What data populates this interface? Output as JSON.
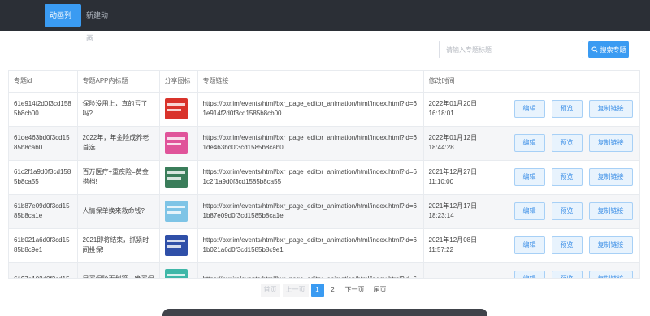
{
  "nav": {
    "items": [
      {
        "label": "动画列表",
        "active": true
      },
      {
        "label": "新建动画",
        "active": false
      }
    ]
  },
  "search": {
    "placeholder": "请输入专题标题",
    "value": "",
    "button_label": "搜索专题"
  },
  "table": {
    "headers": [
      "专题id",
      "专题APP内标题",
      "分享图标",
      "专题链接",
      "修改时间",
      ""
    ],
    "rows": [
      {
        "id": "61e914f2d0f3cd1585b8cb00",
        "title": "保险没用上，真的亏了吗?",
        "thumb_color": "#d9332b",
        "link": "https://bxr.im/events/html/bxr_page_editor_animation/html/index.html?id=61e914f2d0f3cd1585b8cb00",
        "time": "2022年01月20日 16:18:01"
      },
      {
        "id": "61de463bd0f3cd1585b8cab0",
        "title": "2022年，年金险成养老首选",
        "thumb_color": "#e0549a",
        "link": "https://bxr.im/events/html/bxr_page_editor_animation/html/index.html?id=61de463bd0f3cd1585b8cab0",
        "time": "2022年01月12日 18:44:28"
      },
      {
        "id": "61c2f1a9d0f3cd1585b8ca55",
        "title": "百万医疗+重疾险=黄金搭档!",
        "thumb_color": "#3a7d5a",
        "link": "https://bxr.im/events/html/bxr_page_editor_animation/html/index.html?id=61c2f1a9d0f3cd1585b8ca55",
        "time": "2021年12月27日 11:10:00"
      },
      {
        "id": "61b87e09d0f3cd1585b8ca1e",
        "title": "人情保单换来救命钱?",
        "thumb_color": "#7ec4e6",
        "link": "https://bxr.im/events/html/bxr_page_editor_animation/html/index.html?id=61b87e09d0f3cd1585b8ca1e",
        "time": "2021年12月17日 18:23:14"
      },
      {
        "id": "61b021a6d0f3cd1585b8c9e1",
        "title": "2021即将结束，抓紧时间投保!",
        "thumb_color": "#2f4fa8",
        "link": "https://bxr.im/events/html/bxr_page_editor_animation/html/index.html?id=61b021a6d0f3cd1585b8c9e1",
        "time": "2021年12月08日 11:57:22"
      },
      {
        "id": "6197a102d0f3cd15",
        "title": "早买保险更划算，晚买保",
        "thumb_color": "#3fb7a8",
        "link": "https://bxr.im/events/html/bxr_page_editor_animation/html/index.html?id=6",
        "time": ""
      }
    ],
    "actions": {
      "edit": "编辑",
      "preview": "预览",
      "copy": "复制链接"
    }
  },
  "pagination": {
    "first": "首页",
    "prev": "上一页",
    "pages": [
      "1",
      "2"
    ],
    "next": "下一页",
    "last": "尾页"
  }
}
